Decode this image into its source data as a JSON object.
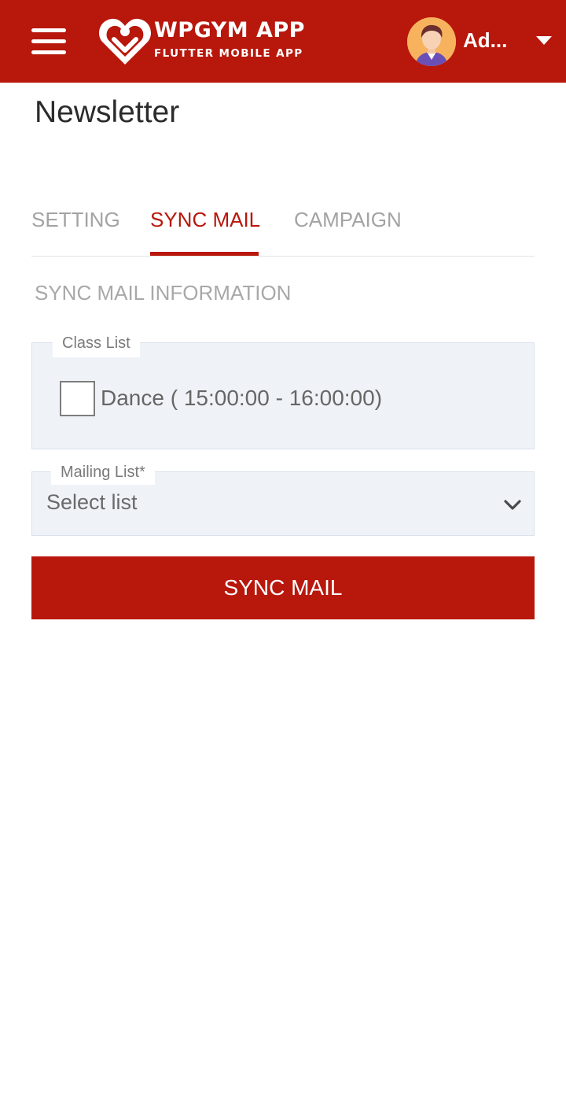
{
  "header": {
    "logo_title": "WPGYM APP",
    "logo_subtitle": "FLUTTER MOBILE APP",
    "user_name": "Ad...",
    "brand_color": "#b8170c",
    "icons": [
      "menu-icon",
      "heart-logo-icon",
      "avatar",
      "caret-down-icon"
    ]
  },
  "page": {
    "title": "Newsletter"
  },
  "tabs": [
    {
      "label": "SETTING",
      "active": false
    },
    {
      "label": "SYNC MAIL",
      "active": true
    },
    {
      "label": "CAMPAIGN",
      "active": false
    }
  ],
  "section": {
    "title": "SYNC MAIL INFORMATION"
  },
  "class_list": {
    "legend": "Class List",
    "items": [
      {
        "label": "Dance ( 15:00:00 - 16:00:00)",
        "checked": false
      }
    ]
  },
  "mailing_list": {
    "legend": "Mailing List*",
    "selected": "Select list",
    "icon": "chevron-down-icon"
  },
  "actions": {
    "sync_label": "SYNC MAIL"
  }
}
